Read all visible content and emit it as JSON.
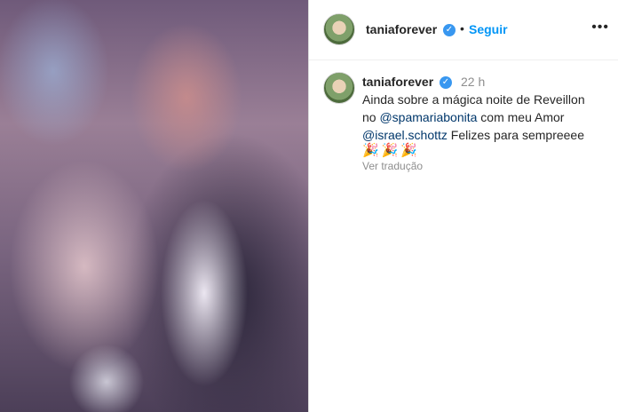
{
  "post": {
    "photo_alt": "photo",
    "header": {
      "username": "taniaforever",
      "follow_label": "Seguir",
      "more_label": "•••",
      "verified_icon": "verified-badge-icon"
    },
    "comment": {
      "username": "taniaforever",
      "time": "22 h",
      "text_line1": "Ainda sobre a mágica noite de Reveillon",
      "text_line2_prefix": "no ",
      "mention1": "@spamariabonita",
      "text_line2_suffix": " com meu Amor",
      "mention2": "@israel.schottz",
      "text_line3_suffix": " Felizes para sempreeee",
      "emojis": "🎉🎉🎉",
      "translate_label": "Ver tradução"
    }
  },
  "colors": {
    "link_blue": "#0095f6",
    "verified_blue": "#3897f0",
    "muted_gray": "#8e8e8e"
  }
}
